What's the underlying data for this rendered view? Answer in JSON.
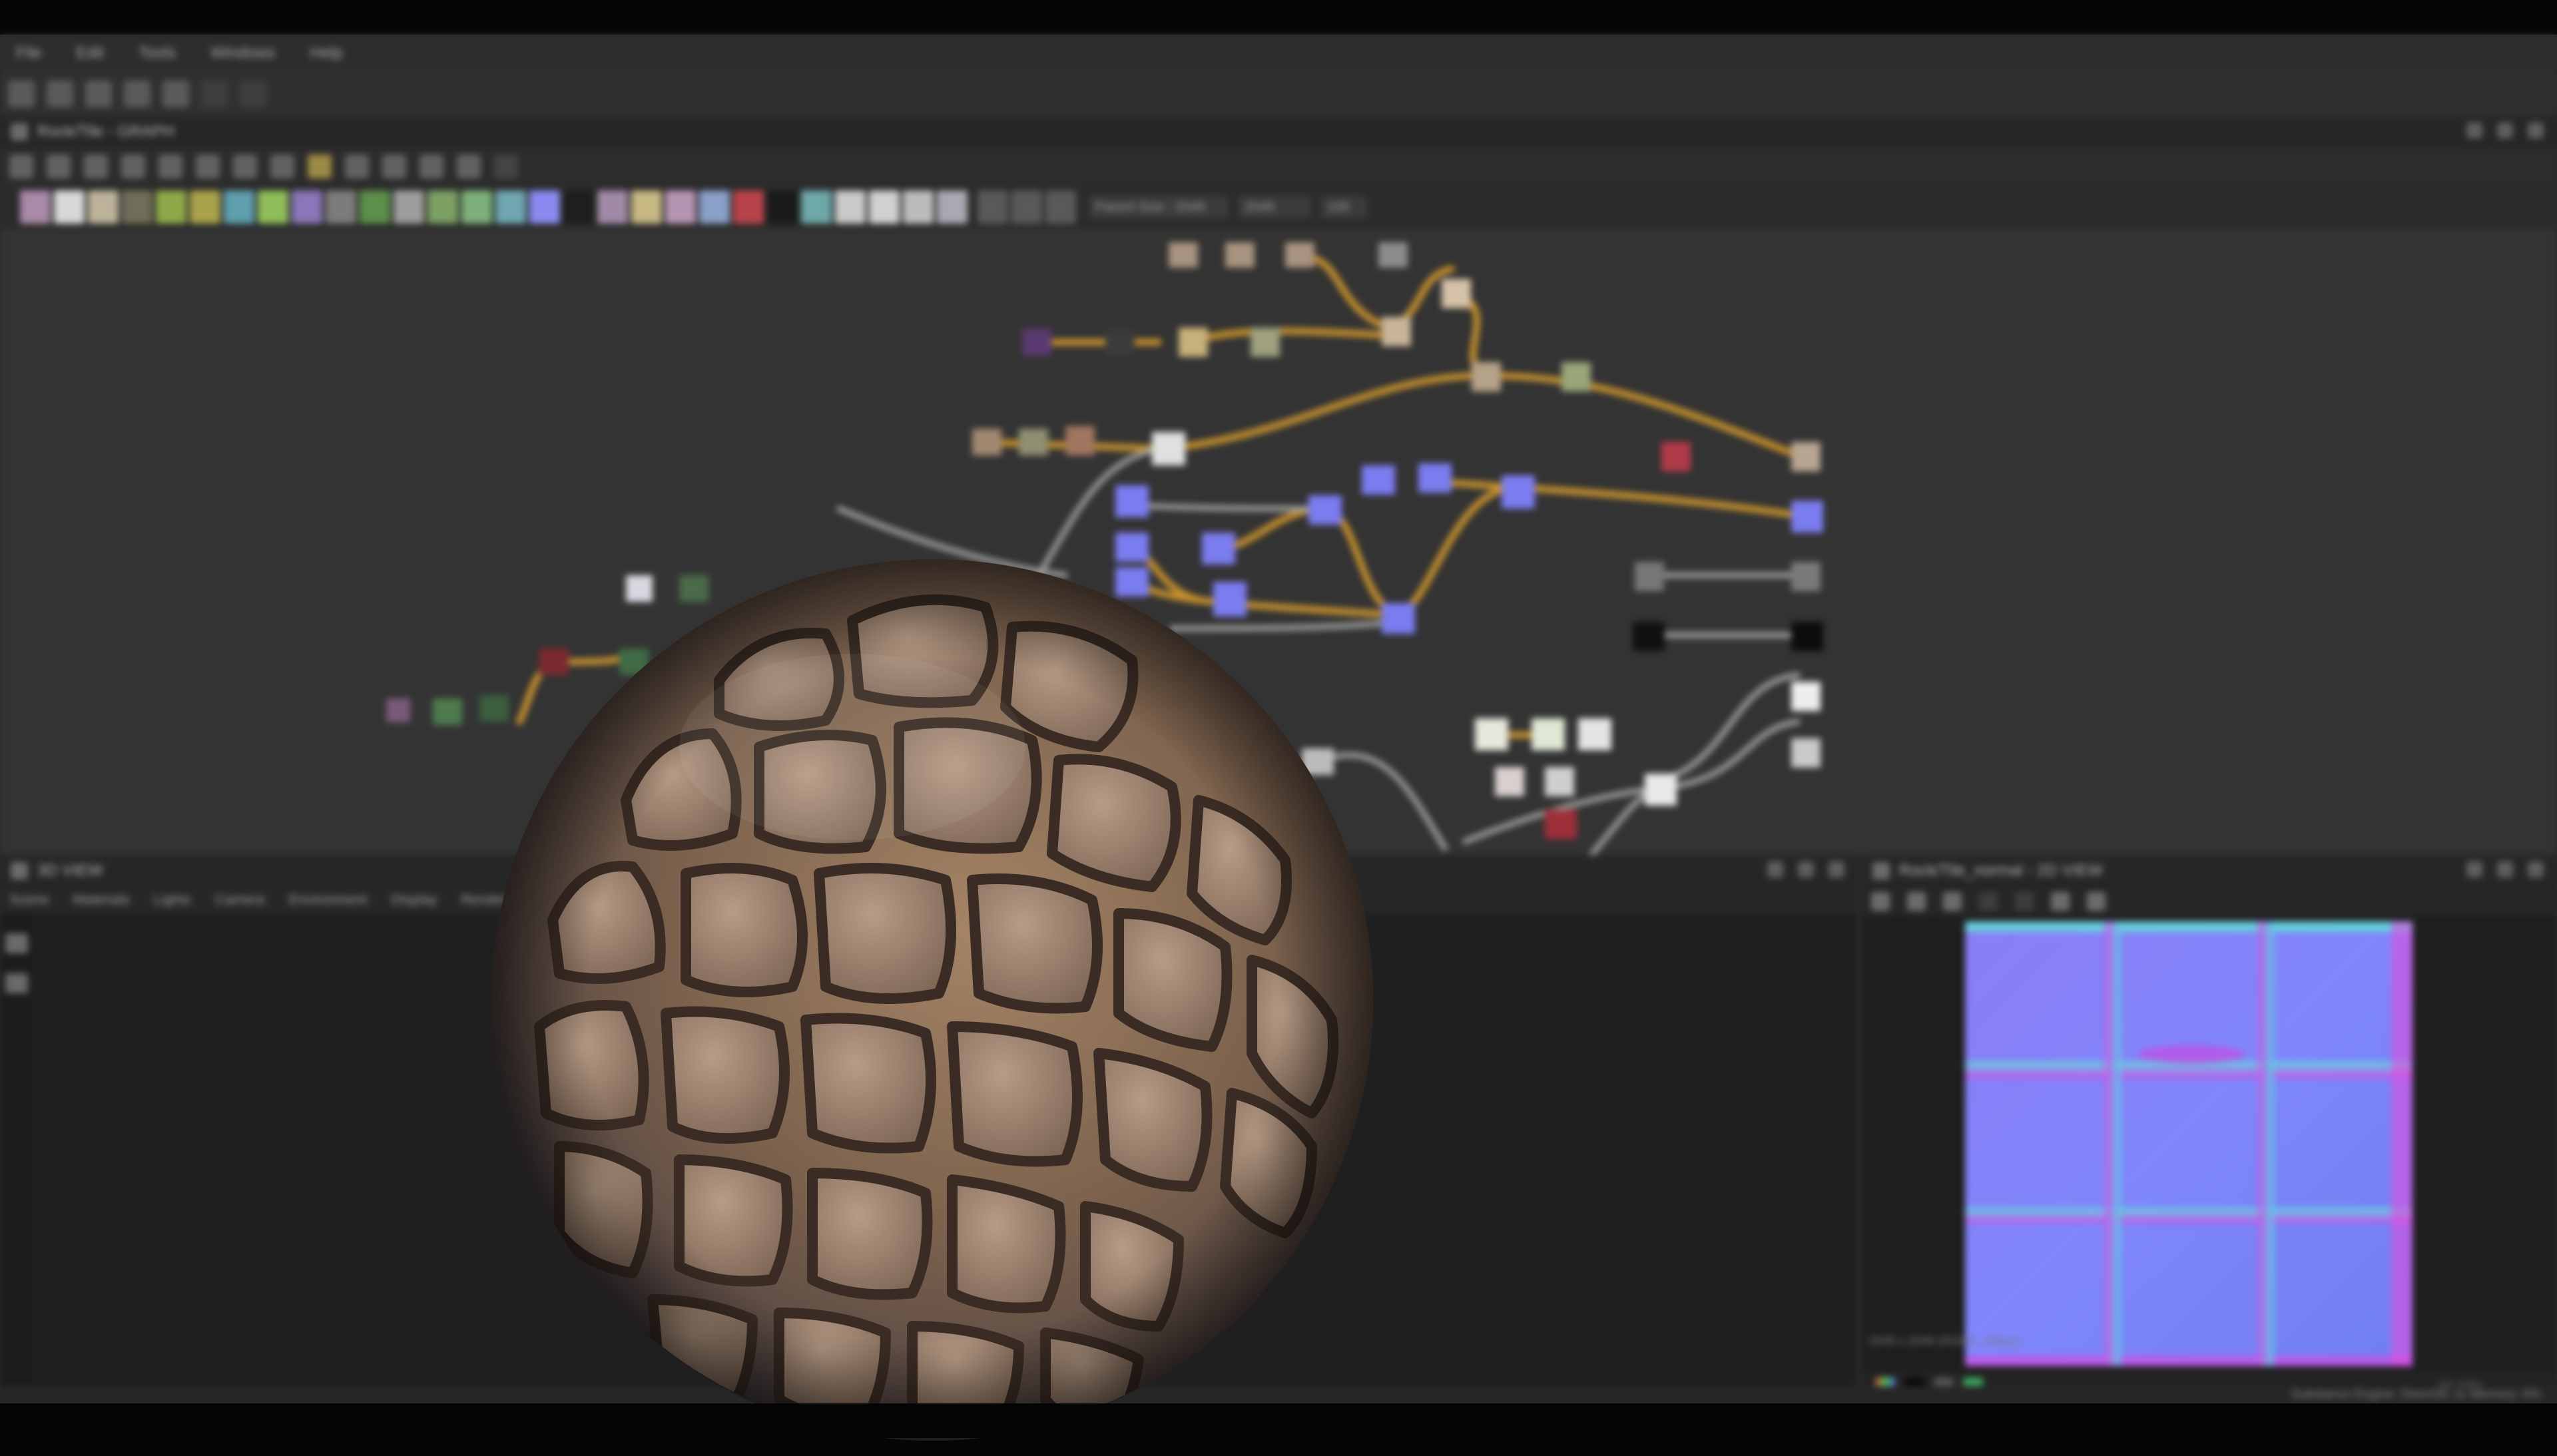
{
  "menubar": [
    "File",
    "Edit",
    "Tools",
    "Windows",
    "Help"
  ],
  "graph_panel": {
    "title": "Rock/Tile - GRAPH"
  },
  "graph_toolbar": {
    "size_label": "Parent Size : 2048",
    "size_value": "2048",
    "zoom_label": "100"
  },
  "viewport3d": {
    "title": "3D VIEW",
    "menu": [
      "Scene",
      "Materials",
      "Lights",
      "Camera",
      "Environment",
      "Display",
      "Renderer"
    ]
  },
  "viewport2d": {
    "title": "Rock/Tile_normal - 2D VIEW",
    "resolution_label": "2048 x 2048 (RGBA, 16bpc)",
    "zoom": "22.19%"
  },
  "status": {
    "engine": "Substance Engine: Direct3D 11  Memory: 8%"
  },
  "colors": {
    "app_bg": "#2a2a2a",
    "graph_bg": "#333333",
    "wire_orange": "#c8922e",
    "wire_grey": "#9a9a9a",
    "node_normal": "#7b7cf0",
    "node_color": "#a8937e",
    "node_grey": "#d9d9d9",
    "node_red": "#9d2f3a",
    "normal_blue": "#7f7fff"
  }
}
